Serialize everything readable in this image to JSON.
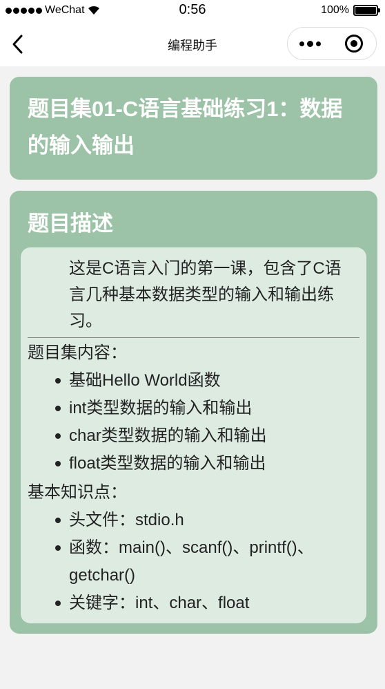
{
  "status_bar": {
    "carrier": "WeChat",
    "time": "0:56",
    "battery": "100%"
  },
  "nav": {
    "title": "编程助手"
  },
  "problem_set": {
    "title": "题目集01-C语言基础练习1：数据的输入输出"
  },
  "description": {
    "heading": "题目描述",
    "intro": "这是C语言入门的第一课，包含了C语言几种基本数据类型的输入和输出练习。",
    "contents_label": "题目集内容：",
    "contents": [
      "基础Hello World函数",
      "int类型数据的输入和输出",
      "char类型数据的输入和输出",
      "float类型数据的输入和输出"
    ],
    "knowledge_label": "基本知识点：",
    "knowledge": [
      "头文件：stdio.h",
      "函数：main()、scanf()、printf()、getchar()",
      "关键字：int、char、float"
    ]
  }
}
